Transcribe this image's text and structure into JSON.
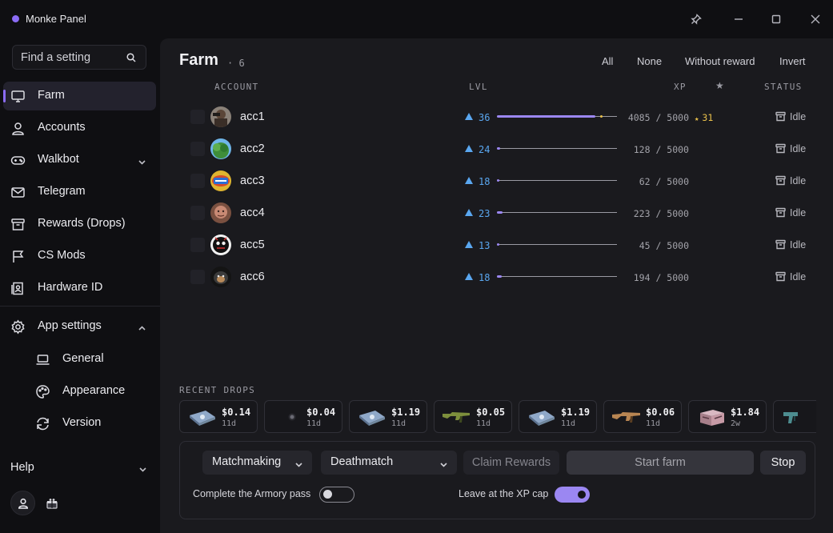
{
  "window": {
    "title": "Monke Panel",
    "accent": "#8b6cf6"
  },
  "sidebar": {
    "search_text": "Find a setting",
    "items": [
      {
        "label": "Farm",
        "icon": "monitor-icon",
        "active": true
      },
      {
        "label": "Accounts",
        "icon": "user-icon"
      },
      {
        "label": "Walkbot",
        "icon": "gamepad-icon",
        "expandable": true
      },
      {
        "label": "Telegram",
        "icon": "mail-icon"
      },
      {
        "label": "Rewards (Drops)",
        "icon": "archive-icon"
      },
      {
        "label": "CS Mods",
        "icon": "flag-icon"
      },
      {
        "label": "Hardware ID",
        "icon": "id-card-icon"
      }
    ],
    "app_settings": {
      "label": "App settings",
      "icon": "gear-icon",
      "expanded": true,
      "children": [
        {
          "label": "General",
          "icon": "laptop-icon"
        },
        {
          "label": "Appearance",
          "icon": "palette-icon"
        },
        {
          "label": "Version",
          "icon": "refresh-icon"
        }
      ]
    },
    "help_label": "Help"
  },
  "farm": {
    "title": "Farm",
    "count": "· 6",
    "filters": [
      "All",
      "None",
      "Without reward",
      "Invert"
    ],
    "columns": {
      "account": "ACCOUNT",
      "lvl": "LVL",
      "xp": "XP",
      "star": "★",
      "status": "STATUS"
    },
    "accounts": [
      {
        "name": "acc1",
        "level": "36",
        "xp_text": "4085 / 5000",
        "xp_fraction": 0.817,
        "stars": "31",
        "status": "Idle"
      },
      {
        "name": "acc2",
        "level": "24",
        "xp_text": "128 / 5000",
        "xp_fraction": 0.026,
        "stars": "",
        "status": "Idle"
      },
      {
        "name": "acc3",
        "level": "18",
        "xp_text": "62 / 5000",
        "xp_fraction": 0.012,
        "stars": "",
        "status": "Idle"
      },
      {
        "name": "acc4",
        "level": "23",
        "xp_text": "223 / 5000",
        "xp_fraction": 0.045,
        "stars": "",
        "status": "Idle"
      },
      {
        "name": "acc5",
        "level": "13",
        "xp_text": "45 / 5000",
        "xp_fraction": 0.009,
        "stars": "",
        "status": "Idle"
      },
      {
        "name": "acc6",
        "level": "18",
        "xp_text": "194 / 5000",
        "xp_fraction": 0.039,
        "stars": "",
        "status": "Idle"
      }
    ]
  },
  "drops": {
    "title": "RECENT DROPS",
    "items": [
      {
        "price": "$0.14",
        "age": "11d",
        "kind": "case"
      },
      {
        "price": "$0.04",
        "age": "11d",
        "kind": "sticker"
      },
      {
        "price": "$1.19",
        "age": "11d",
        "kind": "case"
      },
      {
        "price": "$0.05",
        "age": "11d",
        "kind": "rifle-green"
      },
      {
        "price": "$1.19",
        "age": "11d",
        "kind": "case"
      },
      {
        "price": "$0.06",
        "age": "11d",
        "kind": "rifle-tan"
      },
      {
        "price": "$1.84",
        "age": "2w",
        "kind": "crate"
      },
      {
        "price": "",
        "age": "",
        "kind": "smg-teal"
      }
    ]
  },
  "controls": {
    "mode": "Matchmaking",
    "map_mode": "Deathmatch",
    "claim_label": "Claim Rewards",
    "start_label": "Start farm",
    "stop_label": "Stop",
    "armory_label": "Complete the Armory pass",
    "armory_on": false,
    "xp_cap_label": "Leave at the XP cap",
    "xp_cap_on": true
  }
}
